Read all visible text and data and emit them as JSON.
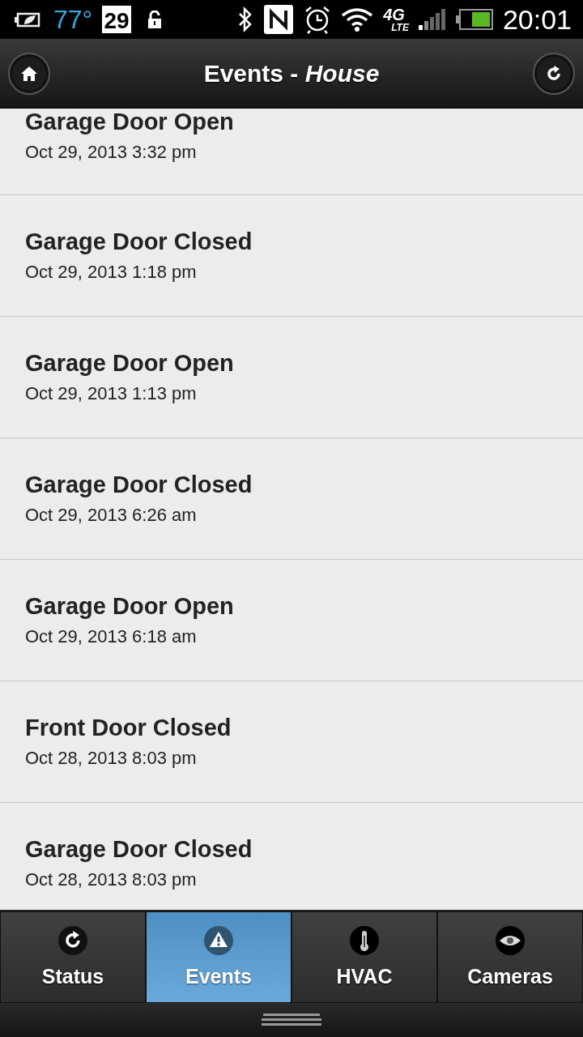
{
  "status_bar": {
    "temperature": "77°",
    "calendar_day": "29",
    "network": "4G",
    "network_sub": "LTE",
    "time": "20:01"
  },
  "header": {
    "title": "Events - *House*"
  },
  "events": [
    {
      "title": "Garage Door Open",
      "date": "Oct 29, 2013 3:32 pm"
    },
    {
      "title": "Garage Door Closed",
      "date": "Oct 29, 2013 1:18 pm"
    },
    {
      "title": "Garage Door Open",
      "date": "Oct 29, 2013 1:13 pm"
    },
    {
      "title": "Garage Door Closed",
      "date": "Oct 29, 2013 6:26 am"
    },
    {
      "title": "Garage Door Open",
      "date": "Oct 29, 2013 6:18 am"
    },
    {
      "title": "Front Door Closed",
      "date": "Oct 28, 2013 8:03 pm"
    },
    {
      "title": "Garage Door Closed",
      "date": "Oct 28, 2013 8:03 pm"
    }
  ],
  "tabs": [
    {
      "label": "Status",
      "kind": "refresh",
      "selected": false
    },
    {
      "label": "Events",
      "kind": "warning",
      "selected": true
    },
    {
      "label": "HVAC",
      "kind": "thermometer",
      "selected": false
    },
    {
      "label": "Cameras",
      "kind": "eye",
      "selected": false
    }
  ]
}
